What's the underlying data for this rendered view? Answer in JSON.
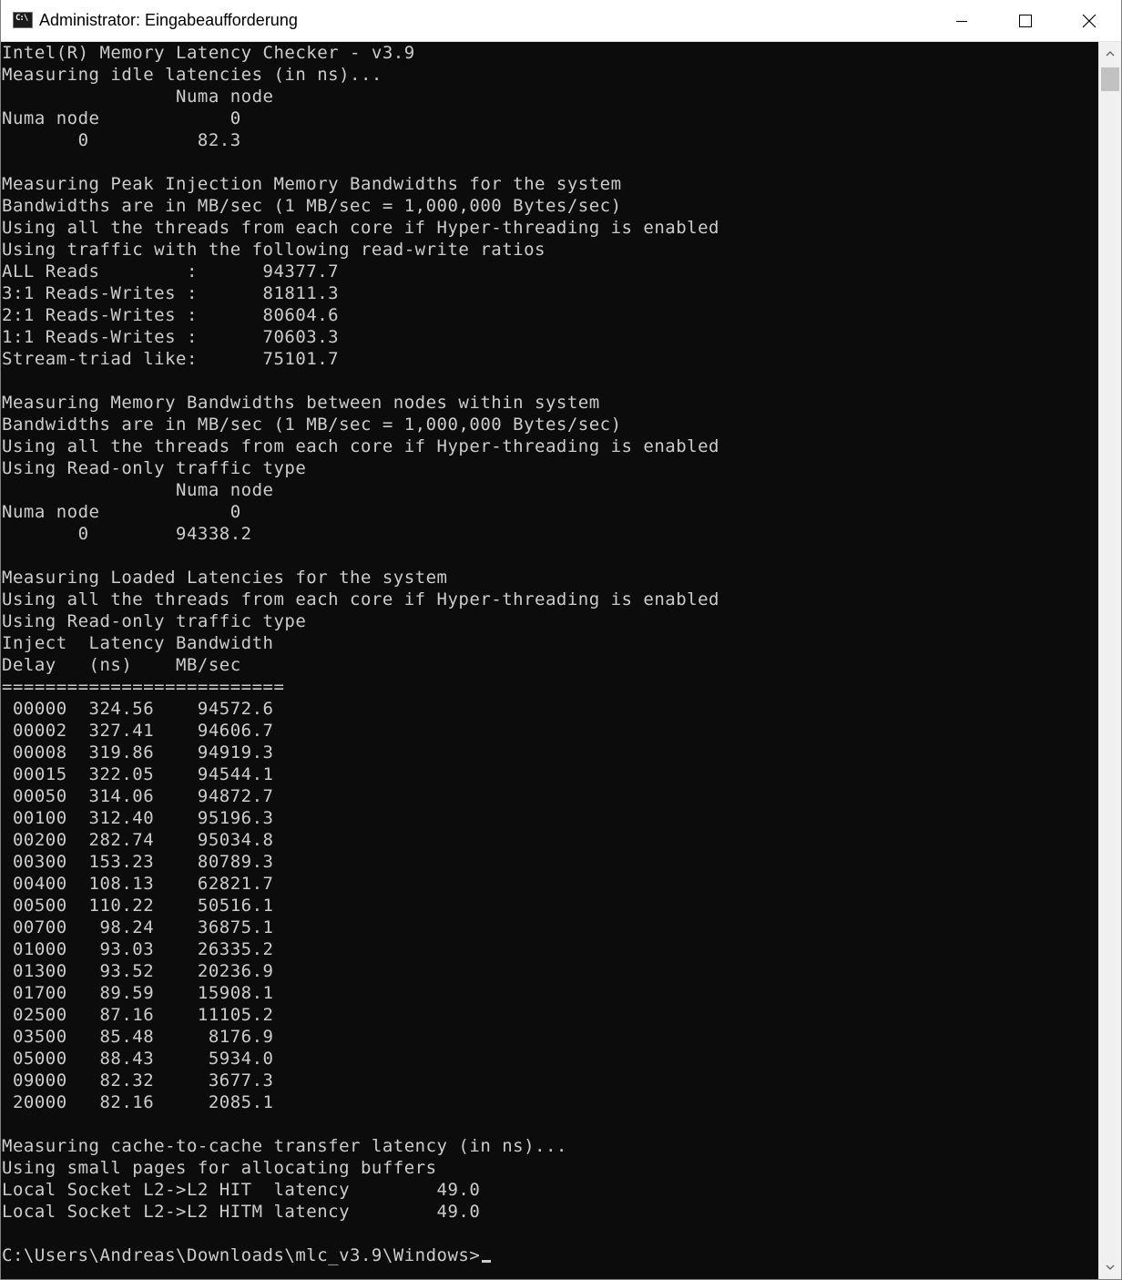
{
  "window": {
    "title": "Administrator: Eingabeaufforderung",
    "icon_label": "C:\\",
    "icon": "cmd-icon",
    "controls": {
      "minimize": "minimize-icon",
      "maximize": "maximize-icon",
      "close": "close-icon"
    }
  },
  "console": {
    "lines": [
      "Intel(R) Memory Latency Checker - v3.9",
      "Measuring idle latencies (in ns)...",
      "                Numa node",
      "Numa node            0",
      "       0          82.3",
      "",
      "Measuring Peak Injection Memory Bandwidths for the system",
      "Bandwidths are in MB/sec (1 MB/sec = 1,000,000 Bytes/sec)",
      "Using all the threads from each core if Hyper-threading is enabled",
      "Using traffic with the following read-write ratios",
      "ALL Reads        :      94377.7",
      "3:1 Reads-Writes :      81811.3",
      "2:1 Reads-Writes :      80604.6",
      "1:1 Reads-Writes :      70603.3",
      "Stream-triad like:      75101.7",
      "",
      "Measuring Memory Bandwidths between nodes within system",
      "Bandwidths are in MB/sec (1 MB/sec = 1,000,000 Bytes/sec)",
      "Using all the threads from each core if Hyper-threading is enabled",
      "Using Read-only traffic type",
      "                Numa node",
      "Numa node            0",
      "       0        94338.2",
      "",
      "Measuring Loaded Latencies for the system",
      "Using all the threads from each core if Hyper-threading is enabled",
      "Using Read-only traffic type",
      "Inject  Latency Bandwidth",
      "Delay   (ns)    MB/sec",
      "==========================",
      " 00000  324.56    94572.6",
      " 00002  327.41    94606.7",
      " 00008  319.86    94919.3",
      " 00015  322.05    94544.1",
      " 00050  314.06    94872.7",
      " 00100  312.40    95196.3",
      " 00200  282.74    95034.8",
      " 00300  153.23    80789.3",
      " 00400  108.13    62821.7",
      " 00500  110.22    50516.1",
      " 00700   98.24    36875.1",
      " 01000   93.03    26335.2",
      " 01300   93.52    20236.9",
      " 01700   89.59    15908.1",
      " 02500   87.16    11105.2",
      " 03500   85.48     8176.9",
      " 05000   88.43     5934.0",
      " 09000   82.32     3677.3",
      " 20000   82.16     2085.1",
      "",
      "Measuring cache-to-cache transfer latency (in ns)...",
      "Using small pages for allocating buffers",
      "Local Socket L2->L2 HIT  latency        49.0",
      "Local Socket L2->L2 HITM latency        49.0",
      "",
      "C:\\Users\\Andreas\\Downloads\\mlc_v3.9\\Windows>"
    ]
  },
  "scrollbar": {
    "up_icon": "scroll-up-arrow-icon",
    "down_icon": "scroll-down-arrow-icon",
    "position": 0
  },
  "colors": {
    "console_bg": "#0c0c0c",
    "console_fg": "#cccccc",
    "titlebar_bg": "#ffffff"
  }
}
